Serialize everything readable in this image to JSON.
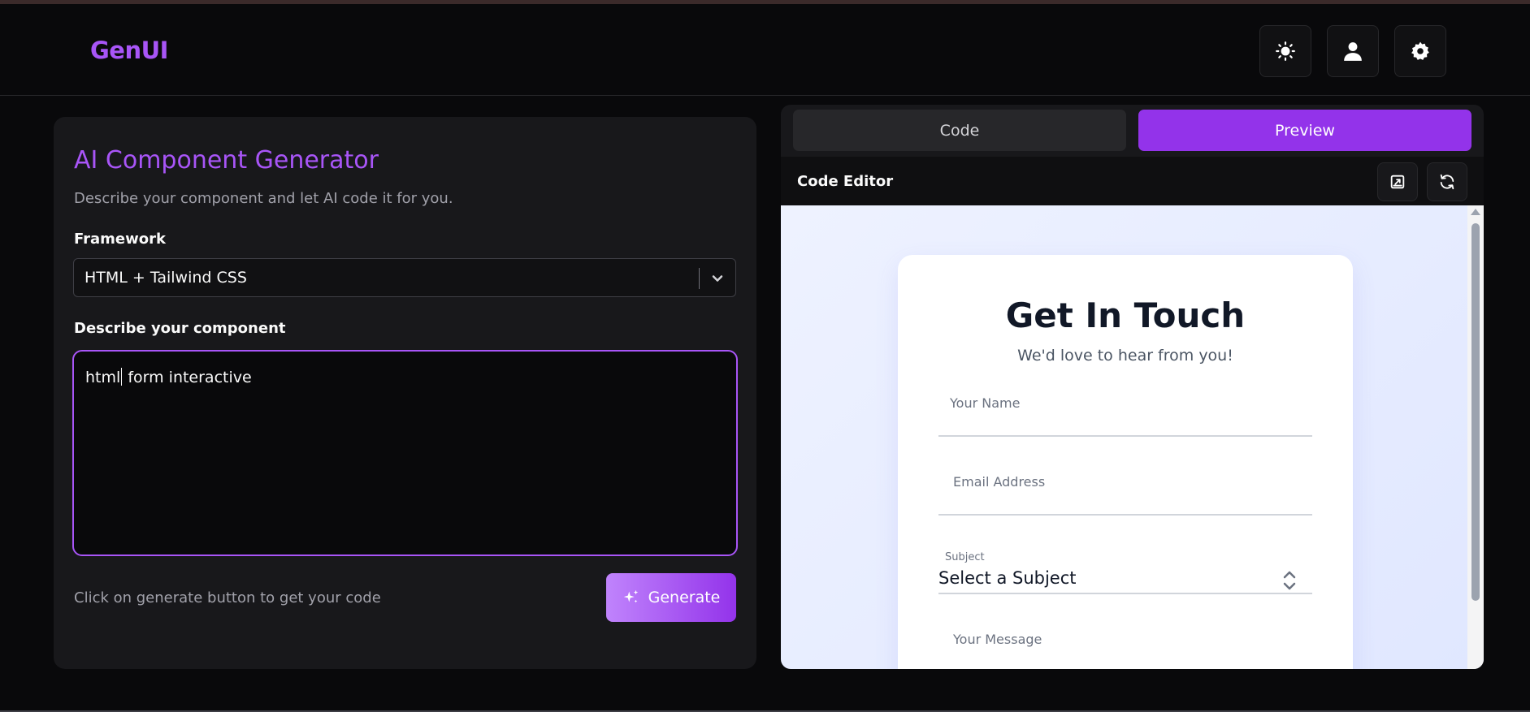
{
  "app": {
    "logo": "GenUI"
  },
  "header": {
    "buttons": [
      {
        "name": "theme-toggle",
        "icon": "sun-icon"
      },
      {
        "name": "profile",
        "icon": "user-icon"
      },
      {
        "name": "settings",
        "icon": "gear-icon"
      }
    ]
  },
  "generator": {
    "title": "AI Component Generator",
    "subtitle": "Describe your component and let AI code it for you.",
    "framework_label": "Framework",
    "framework_value": "HTML + Tailwind CSS",
    "describe_label": "Describe your component",
    "prompt_before_caret": "html",
    "prompt_after_caret": " form interactive",
    "hint": "Click on generate button to get your code",
    "generate_label": "Generate"
  },
  "output": {
    "tabs": [
      "Code",
      "Preview"
    ],
    "active_tab": "Preview",
    "editor_title": "Code Editor",
    "actions": [
      "open-external-icon",
      "refresh-icon"
    ],
    "preview": {
      "heading": "Get In Touch",
      "tagline": "We'd love to hear from you!",
      "name_placeholder": "Your Name",
      "email_placeholder": "Email Address",
      "subject_label": "Subject",
      "subject_value": "Select a Subject",
      "message_placeholder": "Your Message"
    }
  },
  "colors": {
    "accent": "#a855f7",
    "accent_dark": "#9333ea",
    "background": "#09090b",
    "panel": "#18181b"
  }
}
